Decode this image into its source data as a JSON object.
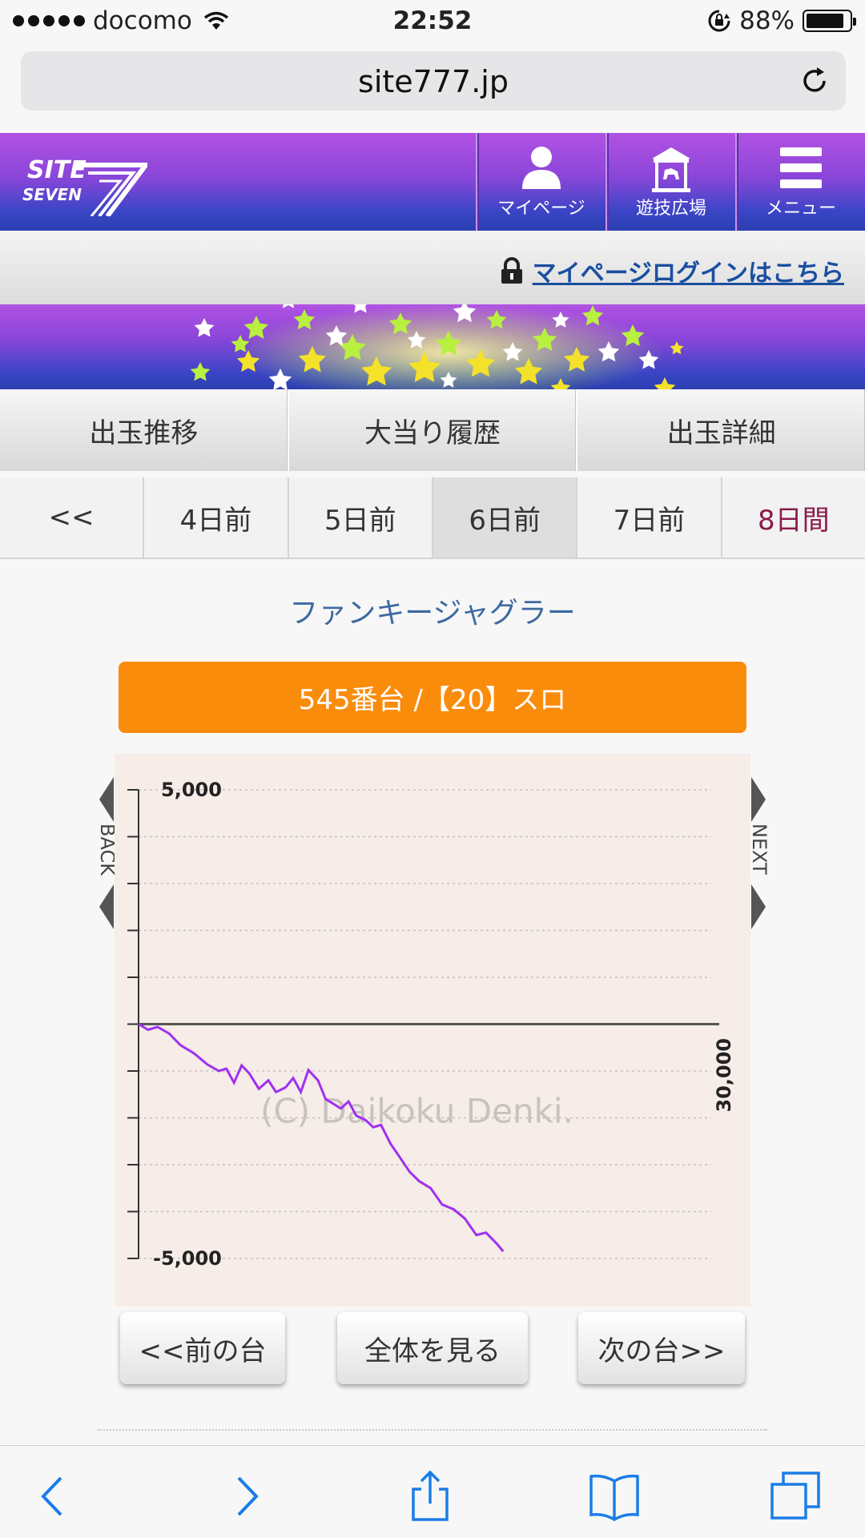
{
  "status_bar": {
    "carrier": "docomo",
    "time": "22:52",
    "battery": "88%"
  },
  "browser": {
    "url": "site777.jp"
  },
  "header": {
    "logo_alt": "SITE SEVEN",
    "nav": [
      {
        "label": "マイページ",
        "icon": "person-icon"
      },
      {
        "label": "遊技広場",
        "icon": "carousel-icon"
      },
      {
        "label": "メニュー",
        "icon": "menu-icon"
      }
    ]
  },
  "login": {
    "text": "マイページログインはこちら"
  },
  "tabs": [
    "出玉推移",
    "大当り履歴",
    "出玉詳細"
  ],
  "days": [
    "<<",
    "4日前",
    "5日前",
    "6日前",
    "7日前",
    "8日間"
  ],
  "machine": {
    "name": "ファンキージャグラー",
    "badge": "545番台 /【20】スロ"
  },
  "chart_data": {
    "type": "line",
    "title": "",
    "xlabel": "",
    "ylabel": "",
    "ylim": [
      -5000,
      5000
    ],
    "xlim": [
      0,
      30000
    ],
    "ytick_labels": [
      "5,000",
      "-5,000"
    ],
    "x_end_label": "30,000",
    "watermark": "(C) Daikoku Denki.",
    "series": [
      {
        "color": "#a030f0",
        "x": [
          0,
          500,
          1000,
          1600,
          2200,
          2900,
          3600,
          4200,
          4600,
          5000,
          5400,
          5800,
          6300,
          6800,
          7200,
          7700,
          8100,
          8500,
          8900,
          9400,
          9800,
          10200,
          10600,
          11000,
          11400,
          11900,
          12300,
          12700,
          13200,
          13700,
          14200,
          14700,
          15300,
          15900,
          16500,
          17100,
          17700,
          18200,
          18800,
          19100
        ],
        "y": [
          0,
          -120,
          -60,
          -200,
          -450,
          -620,
          -860,
          -1000,
          -950,
          -1250,
          -880,
          -1050,
          -1380,
          -1200,
          -1450,
          -1350,
          -1150,
          -1450,
          -980,
          -1200,
          -1600,
          -1700,
          -1800,
          -1650,
          -1950,
          -2050,
          -2200,
          -2150,
          -2550,
          -2850,
          -3150,
          -3350,
          -3500,
          -3850,
          -3950,
          -4150,
          -4500,
          -4450,
          -4700,
          -4850
        ]
      }
    ],
    "grid": "dotted horizontal",
    "legend": "none"
  },
  "side_nav": {
    "back": "BACK",
    "next": "NEXT"
  },
  "buttons": {
    "prev": "<<前の台",
    "all": "全体を見る",
    "next": "次の台>>"
  },
  "toolbar": [
    "back-icon",
    "forward-icon",
    "share-icon",
    "bookmarks-icon",
    "tabs-icon"
  ]
}
